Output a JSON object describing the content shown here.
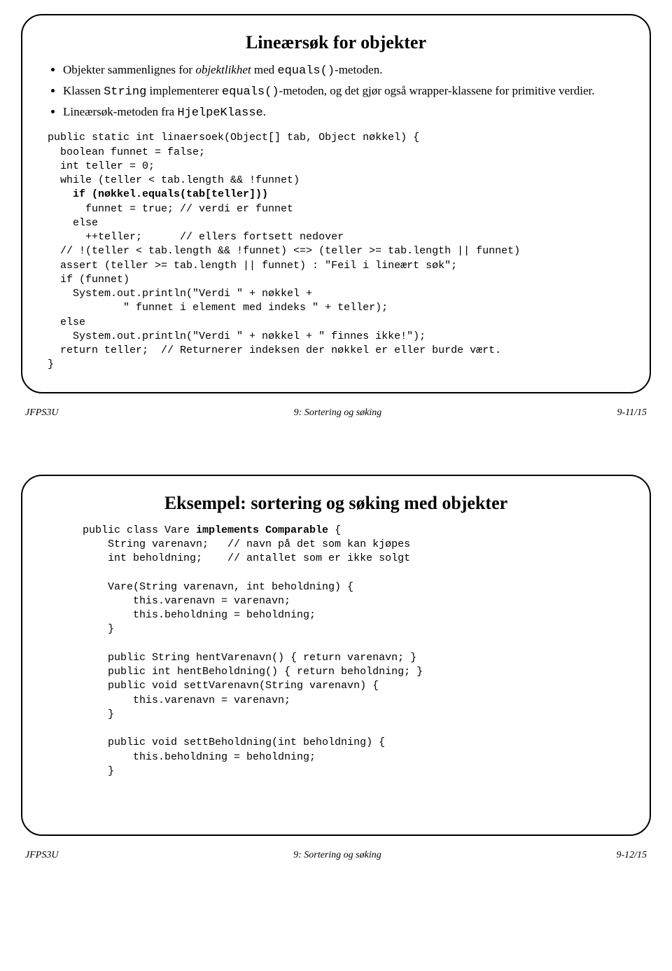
{
  "slide1": {
    "title": "Lineærsøk for objekter",
    "b1_pre": "Objekter sammenlignes for ",
    "b1_it": "objektlikhet",
    "b1_mid": " med ",
    "b1_mono": "equals()",
    "b1_post": "-metoden.",
    "b2_pre": "Klassen ",
    "b2_mono1": "String",
    "b2_mid1": " implementerer ",
    "b2_mono2": "equals()",
    "b2_post": "-metoden, og det gjør også wrapper-klassene for primitive verdier.",
    "b3_pre": "Lineærsøk-metoden fra ",
    "b3_mono": "HjelpeKlasse",
    "b3_post": ".",
    "code_l1": "public static int linaersoek(Object[] tab, Object nøkkel) {",
    "code_l2": "  boolean funnet = false;",
    "code_l3": "  int teller = 0;",
    "code_l4": "  while (teller < tab.length && !funnet)",
    "code_l5a": "    ",
    "code_l5b": "if (nøkkel.equals(tab[teller]))",
    "code_l6": "      funnet = true; // verdi er funnet",
    "code_l7": "    else",
    "code_l8": "      ++teller;      // ellers fortsett nedover",
    "code_l9": "  // !(teller < tab.length && !funnet) <=> (teller >= tab.length || funnet)",
    "code_l10": "  assert (teller >= tab.length || funnet) : \"Feil i lineært søk\";",
    "code_l11": "  if (funnet)",
    "code_l12": "    System.out.println(\"Verdi \" + nøkkel +",
    "code_l13": "            \" funnet i element med indeks \" + teller);",
    "code_l14": "  else",
    "code_l15": "    System.out.println(\"Verdi \" + nøkkel + \" finnes ikke!\");",
    "code_l16": "  return teller;  // Returnerer indeksen der nøkkel er eller burde vært.",
    "code_l17": "}"
  },
  "footer1": {
    "left": "JFPS3U",
    "center": "9: Sortering og søking",
    "right": "9-11/15"
  },
  "slide2": {
    "title": "Eksempel: sortering og søking med objekter",
    "code_l1a": "public class Vare ",
    "code_l1b": "implements Comparable",
    "code_l1c": " {",
    "code_l2": "    String varenavn;   // navn på det som kan kjøpes",
    "code_l3": "    int beholdning;    // antallet som er ikke solgt",
    "code_l4": "",
    "code_l5": "    Vare(String varenavn, int beholdning) {",
    "code_l6": "        this.varenavn = varenavn;",
    "code_l7": "        this.beholdning = beholdning;",
    "code_l8": "    }",
    "code_l9": "",
    "code_l10": "    public String hentVarenavn() { return varenavn; }",
    "code_l11": "    public int hentBeholdning() { return beholdning; }",
    "code_l12": "    public void settVarenavn(String varenavn) {",
    "code_l13": "        this.varenavn = varenavn;",
    "code_l14": "    }",
    "code_l15": "",
    "code_l16": "    public void settBeholdning(int beholdning) {",
    "code_l17": "        this.beholdning = beholdning;",
    "code_l18": "    }"
  },
  "footer2": {
    "left": "JFPS3U",
    "center": "9: Sortering og søking",
    "right": "9-12/15"
  }
}
